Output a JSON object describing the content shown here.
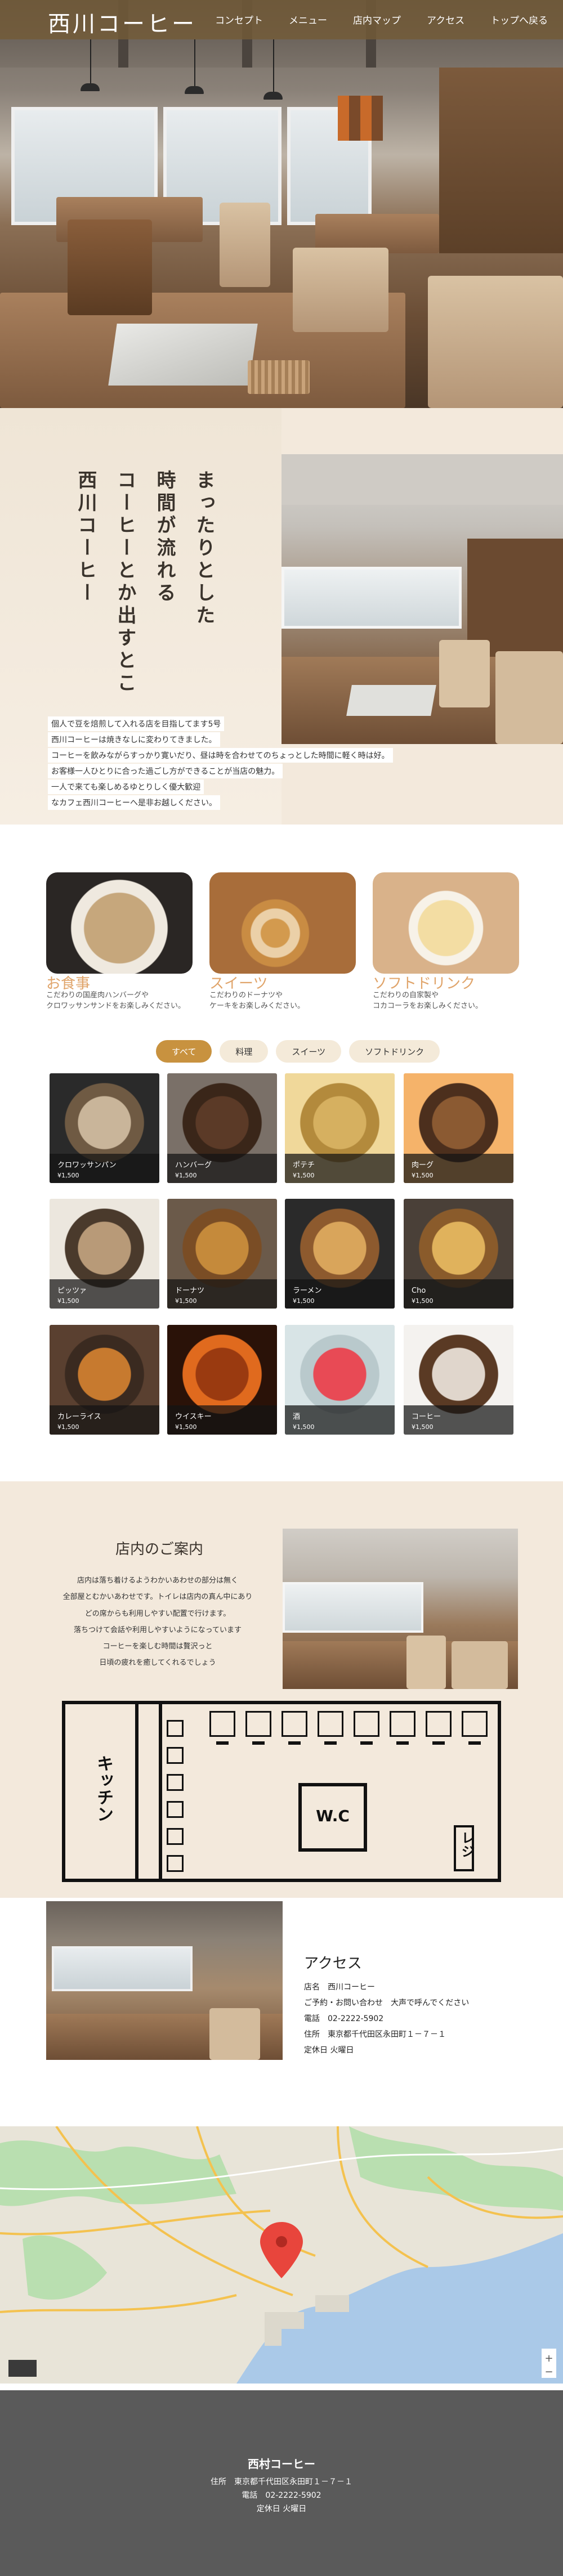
{
  "header": {
    "logo": "西川コーヒー",
    "nav": [
      "コンセプト",
      "メニュー",
      "店内マップ",
      "アクセス",
      "トップへ戻る"
    ]
  },
  "concept": {
    "headline_lines": [
      "まったりとした",
      "時間が流れる",
      "コーヒーとか出すとこ",
      "西川コーヒー"
    ],
    "body_lines": [
      "個人で豆を焙煎して入れる店を目指してます5号",
      "西川コーヒーは焼きなしに変わりてきました。",
      "コーヒーを飲みながらすっかり寛いだり、昼は時を合わせてのちょっとした時間に軽く時は好。",
      "お客様一人ひとりに合った過ごし方ができることが当店の魅力。",
      "一人で来ても楽しめるゆとりしく優大歓迎",
      "なカフェ西川コーヒーへ是非お越しください。"
    ]
  },
  "categories": [
    {
      "title": "お食事",
      "desc": [
        "こだわりの国産肉ハンバーグや",
        "クロワッサンサンドをお楽しみください。"
      ]
    },
    {
      "title": "スイーツ",
      "desc": [
        "こだわりのドーナツや",
        "ケーキをお楽しみください。"
      ]
    },
    {
      "title": "ソフトドリンク",
      "desc": [
        "こだわりの自家製や",
        "コカコーラをお楽しみください。"
      ]
    }
  ],
  "filters": [
    "すべて",
    "料理",
    "スイーツ",
    "ソフトドリンク"
  ],
  "menu_items": [
    {
      "name": "クロワッサンパン",
      "price": "¥1,500",
      "palette": [
        "#2a2a2a",
        "#c9b59a",
        "#6f5a43"
      ]
    },
    {
      "name": "ハンバーグ",
      "price": "¥1,500",
      "palette": [
        "#7a7068",
        "#5b3a27",
        "#3a2619"
      ]
    },
    {
      "name": "ポテチ",
      "price": "¥1,500",
      "palette": [
        "#f0d89a",
        "#d6b060",
        "#b38a3c"
      ]
    },
    {
      "name": "肉ーグ",
      "price": "¥1,500",
      "palette": [
        "#f5b36a",
        "#8b5a32",
        "#4c2f1d"
      ]
    },
    {
      "name": "ピッツァ",
      "price": "¥1,500",
      "palette": [
        "#ece7de",
        "#b89a78",
        "#4a3a2c"
      ]
    },
    {
      "name": "ドーナツ",
      "price": "¥1,500",
      "palette": [
        "#6b5a4a",
        "#c58a3b",
        "#7a4d25"
      ]
    },
    {
      "name": "ラーメン",
      "price": "¥1,500",
      "palette": [
        "#2a2a2a",
        "#d9a55b",
        "#8d5a2e"
      ]
    },
    {
      "name": "Cho",
      "price": "¥1,500",
      "palette": [
        "#4a4038",
        "#e0b25c",
        "#8a5b2b"
      ]
    },
    {
      "name": "カレーライス",
      "price": "¥1,500",
      "palette": [
        "#5a4030",
        "#c77a2f",
        "#3a2a20"
      ]
    },
    {
      "name": "ウイスキー",
      "price": "¥1,500",
      "palette": [
        "#2a1208",
        "#9a3a10",
        "#e06a1e"
      ]
    },
    {
      "name": "酒",
      "price": "¥1,500",
      "palette": [
        "#d8e4e6",
        "#e84a55",
        "#b9c9cc"
      ]
    },
    {
      "name": "コーヒー",
      "price": "¥1,500",
      "palette": [
        "#f4f2ef",
        "#e0d6cc",
        "#5a3a24"
      ]
    }
  ],
  "floor": {
    "title": "店内のご案内",
    "body_lines": [
      "店内は落ち着けるようわかいあわせの部分は無く",
      "全部屋とむかいあわせです。トイレは店内の真ん中にあり",
      "どの席からも利用しやすい配置で行けます。",
      "落ちつけて会話や利用しやすいようになっています",
      "コーヒーを楽しむ時間は贅沢っと",
      "日頃の疲れを癒してくれるでしょう"
    ],
    "kitchen_label": "キッチン",
    "wc_label": "W.C",
    "register_label": "レジ"
  },
  "access": {
    "title": "アクセス",
    "lines": [
      "店名　西川コーヒー",
      "ご予約・お問い合わせ　大声で呼んでください",
      "電話　02-2222-5902",
      "住所　東京都千代田区永田町１－７－１",
      "定休日  火曜日"
    ]
  },
  "map": {
    "land": "#e8e4d8",
    "park": "#b9dfb0",
    "water": "#9ec4ea",
    "pin": "#e8453c"
  },
  "footer": {
    "name": "西村コーヒー",
    "lines": [
      "住所　東京都千代田区永田町１－７－１",
      "電話　02-2222-5902",
      "定休日 火曜日"
    ]
  },
  "colors": {
    "accent": "#c8923f",
    "cream": "#f3e9dc",
    "header_bar": "#735a37",
    "footer": "#5a5a5a"
  }
}
